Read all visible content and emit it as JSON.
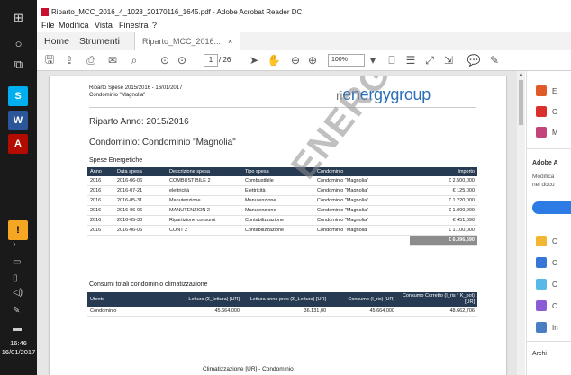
{
  "taskbar": {
    "clock_time": "16:46",
    "clock_date": "16/01/2017"
  },
  "window": {
    "title": "Riparto_MCC_2016_4_1028_20170116_1645.pdf - Adobe Acrobat Reader DC"
  },
  "menubar": {
    "items": [
      "File",
      "Modifica",
      "Vista",
      "Finestra",
      "?"
    ]
  },
  "tabs": {
    "home": "Home",
    "tools": "Strumenti",
    "doc": "Riparto_MCC_2016...",
    "close": "×"
  },
  "toolbar": {
    "page_current": "1",
    "page_total": "/ 26",
    "zoom": "100%"
  },
  "right_pane": {
    "items": [
      "E",
      "C",
      "M",
      "Adobe A",
      "Modifica",
      "nei docu",
      "C",
      "C",
      "C",
      "C",
      "In",
      "Archi"
    ]
  },
  "document": {
    "header_line1": "Riparto Spese 2015/2016 - 16/01/2017",
    "header_line2": "Condominio \"Magnolia\"",
    "logo_text": "energygroup",
    "logo_prefix": "ri",
    "title": "Riparto Anno: 2015/2016",
    "condominio": "Condominio: Condominio \"Magnolia\"",
    "section1": "Spese Energetiche",
    "table1": {
      "headers": [
        "Anno",
        "Data spesa",
        "Descrizione spesa",
        "Tipo spesa",
        "Condominio",
        "Importo"
      ],
      "rows": [
        [
          "2016",
          "2016-06-06",
          "COMBUSTIBILE 2",
          "Combustibile",
          "Condominio \"Magnolia\"",
          "€ 2.500,000"
        ],
        [
          "2016",
          "2016-07-21",
          "elettricità",
          "Elettricità",
          "Condominio \"Magnolia\"",
          "€ 125,000"
        ],
        [
          "2016",
          "2016-05-31",
          "Manutenzione",
          "Manutenzione",
          "Condominio \"Magnolia\"",
          "€ 1.220,000"
        ],
        [
          "2016",
          "2016-06-06",
          "MANUTENZION 2",
          "Manutenzione",
          "Condominio \"Magnolia\"",
          "€ 1.000,000"
        ],
        [
          "2016",
          "2016-05-30",
          "Ripartizione consumi",
          "Contabilizzazione",
          "Condominio \"Magnolia\"",
          "€ 451,690"
        ],
        [
          "2016",
          "2016-06-06",
          "CONT 2",
          "Contabilizzazione",
          "Condominio \"Magnolia\"",
          "€ 1.100,000"
        ]
      ],
      "total": "€ 6.396,690"
    },
    "section2": "Consumi totali condominio climatizzazione",
    "table2": {
      "headers": [
        "Utente",
        "Lettura (Σ_lettura) [UR]",
        "Lettura anno prec (Σ_Lettura) [UR]",
        "Consumo (I_ris) [UR]",
        "Consumo Corretto (I_ris * K_pot) [UR]"
      ],
      "rows": [
        [
          "Condominio",
          "45.664,000",
          "36.131,00",
          "45.664,000",
          "48.662,706"
        ]
      ]
    },
    "watermark": "ENERGYGROUP",
    "footer_caption": "Climatizzazione [UR] - Condominio"
  }
}
